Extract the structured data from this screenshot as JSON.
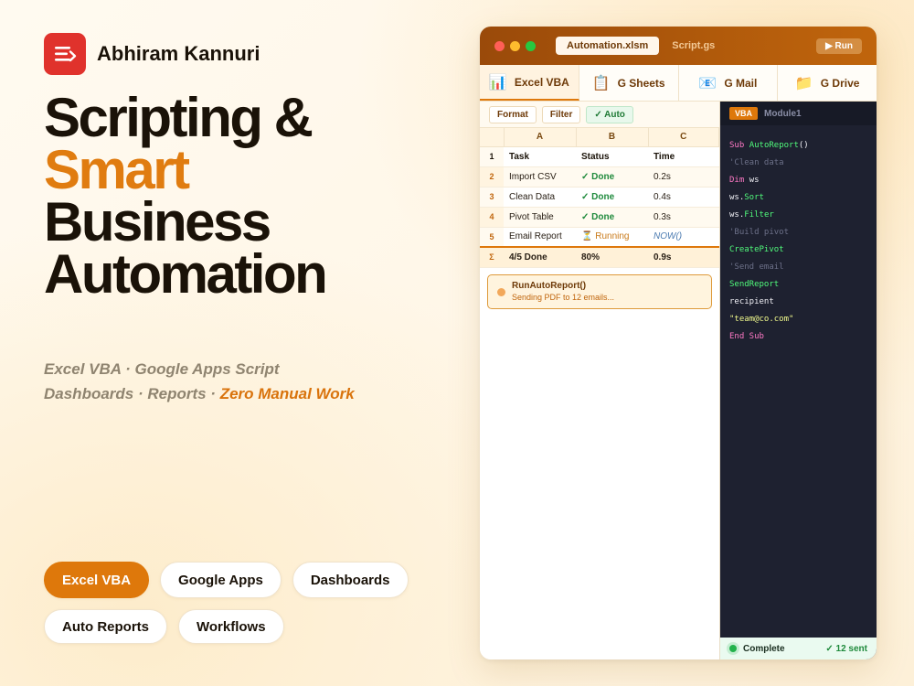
{
  "brand": {
    "name": "Abhiram Kannuri",
    "logo_icon": "hamburger-arrow-icon",
    "logo_color": "#e0322c"
  },
  "headline": {
    "line1": "Scripting &",
    "line2": "Smart",
    "line3": "Business",
    "line4": "Automation"
  },
  "subtitle": {
    "line1": "Excel VBA · Google Apps Script",
    "line2_prefix": "Dashboards · Reports · ",
    "line2_highlight": "Zero Manual Work"
  },
  "chips": [
    "Excel VBA",
    "Google Apps",
    "Dashboards",
    "Auto Reports",
    "Workflows"
  ],
  "window": {
    "files": [
      "Automation.xlsm",
      "Script.gs"
    ],
    "run_label": "▶ Run",
    "service_tabs": [
      {
        "label": "Excel VBA",
        "icon": "📊"
      },
      {
        "label": "G Sheets",
        "icon": "📋"
      },
      {
        "label": "G Mail",
        "icon": "📧"
      },
      {
        "label": "G Drive",
        "icon": "📁"
      }
    ],
    "toolbar": [
      "Format",
      "Filter",
      "✓ Auto"
    ],
    "columns": [
      "A",
      "B",
      "C"
    ],
    "header_row": {
      "num": "1",
      "a": "Task",
      "b": "Status",
      "c": "Time"
    },
    "rows": [
      {
        "num": "2",
        "task": "Import CSV",
        "status": "✓ Done",
        "time": "0.2s"
      },
      {
        "num": "3",
        "task": "Clean Data",
        "status": "✓ Done",
        "time": "0.4s"
      },
      {
        "num": "4",
        "task": "Pivot Table",
        "status": "✓ Done",
        "time": "0.3s"
      },
      {
        "num": "5",
        "task": "Email Report",
        "status": "⏳ Running",
        "time": "NOW()"
      }
    ],
    "summary": {
      "num": "Σ",
      "task": "4/5 Done",
      "status": "80%",
      "time": "0.9s"
    },
    "alert": {
      "title": "RunAutoReport()",
      "subtitle": "Sending PDF to 12 emails..."
    },
    "editor": {
      "badge": "VBA",
      "module": "Module1",
      "code": {
        "l1_kw": "Sub ",
        "l1_fn": "AutoReport",
        "l1_pl": "()",
        "l2": "'Clean data",
        "l3_kw": "Dim ",
        "l3_pl": "ws",
        "l4_pl": "ws.",
        "l4_fn": "Sort",
        "l5_pl": "ws.",
        "l5_fn": "Filter",
        "l6": "'Build pivot",
        "l7": "CreatePivot",
        "l8": "'Send email",
        "l9": "SendReport",
        "l10": "recipient",
        "l11": "\"team@co.com\"",
        "l12": "End Sub"
      }
    },
    "status": {
      "left": "Complete",
      "right": "✓ 12 sent"
    }
  },
  "colors": {
    "accent": "#de780b",
    "dark_text": "#1a1208",
    "success": "#1f8a3c",
    "editor_bg": "#1e2130"
  }
}
